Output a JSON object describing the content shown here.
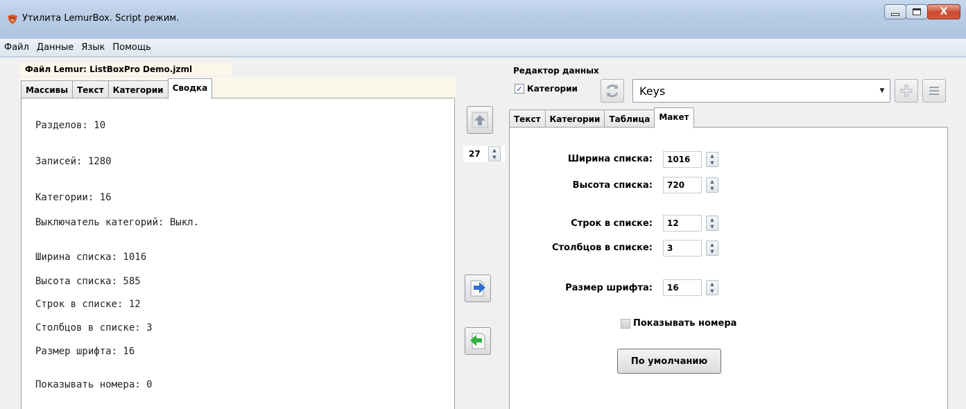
{
  "window": {
    "title": "Утилита LemurBox. Script режим.",
    "close_glyph": "X"
  },
  "menu": [
    "Файл",
    "Данные",
    "Язык",
    "Помощь"
  ],
  "left": {
    "file_label": "Файл Lemur:  ListBoxPro Demo.jzml",
    "tabs": [
      "Массивы",
      "Текст",
      "Категории",
      "Сводка"
    ],
    "active_tab": "Сводка",
    "summary": [
      "Разделов: 10",
      "Записей: 1280",
      "Категории: 16",
      "Выключатель категорий: Выкл.",
      "Ширина списка: 1016",
      "Высота списка: 585",
      "Строк в списке: 12",
      "Столбцов в списке: 3",
      "Размер шрифта: 16",
      "Показывать номера: 0"
    ]
  },
  "middle": {
    "spin_value": "27"
  },
  "right": {
    "title": "Редактор данных",
    "categories_checkbox": {
      "label": "Категории",
      "checked": true,
      "glyph": "✓"
    },
    "combo_value": "Keys",
    "tabs": [
      "Текст",
      "Категории",
      "Таблица",
      "Макет"
    ],
    "active_tab": "Макет",
    "fields": {
      "list_width": {
        "label": "Ширина списка:",
        "value": "1016"
      },
      "list_height": {
        "label": "Высота списка:",
        "value": "720"
      },
      "rows": {
        "label": "Строк в списке:",
        "value": "12"
      },
      "columns": {
        "label": "Столбцов в списке:",
        "value": "3"
      },
      "font_size": {
        "label": "Размер шрифта:",
        "value": "16"
      }
    },
    "show_numbers": {
      "label": "Показывать номера",
      "checked": false
    },
    "default_button": "По умолчанию"
  },
  "colors": {
    "titlebar": "#b9cde6",
    "client_bg": "#f0f0f0",
    "tab_strip_bg": "#fbf7ea",
    "close_button": "#c94a2f",
    "arrow_blue": "#2f6fd1",
    "arrow_green": "#2fb43a"
  },
  "icons": {
    "app": "lemur-app-icon",
    "up": "move-up-icon",
    "right": "export-right-icon",
    "left": "import-left-icon",
    "refresh": "refresh-icon",
    "add": "plus-icon",
    "menu": "list-menu-icon"
  }
}
